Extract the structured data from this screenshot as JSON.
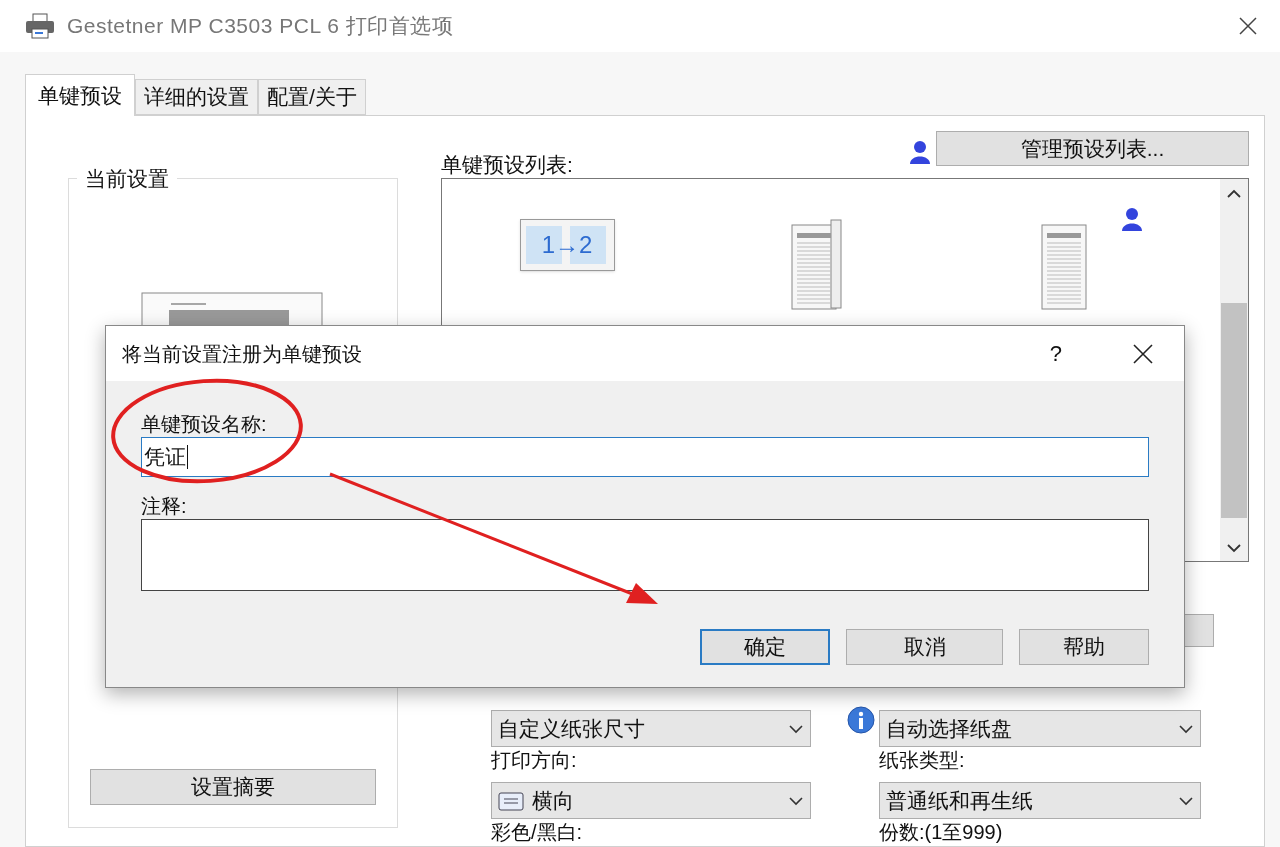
{
  "window": {
    "title": "Gestetner MP C3503 PCL 6 打印首选项"
  },
  "tabs": [
    {
      "label": "单键预设",
      "selected": true
    },
    {
      "label": "详细的设置",
      "selected": false
    },
    {
      "label": "配置/关于",
      "selected": false
    }
  ],
  "current_settings": {
    "title": "当前设置",
    "summary_button": "设置摘要"
  },
  "preset_list": {
    "label": "单键预设列表:",
    "manage_button": "管理预设列表...",
    "items": [
      {
        "kind": "duplex",
        "label": "1→2",
        "user": false
      },
      {
        "kind": "booklet",
        "user": false
      },
      {
        "kind": "document",
        "user": true
      }
    ]
  },
  "settings": [
    {
      "value": "自定义纸张尺寸",
      "kind": "select"
    },
    {
      "value": "自动选择纸盘",
      "kind": "select-info"
    },
    {
      "label": "打印方向:",
      "value": "横向",
      "kind": "select-orientation"
    },
    {
      "label": "纸张类型:",
      "value": "普通纸和再生纸",
      "kind": "select"
    },
    {
      "label": "彩色/黑白:",
      "kind": "label"
    },
    {
      "label": "份数:(1至999)",
      "kind": "label"
    }
  ],
  "dialog": {
    "title": "将当前设置注册为单键预设",
    "help": "?",
    "name_label": "单键预设名称:",
    "name_value": "凭证",
    "comment_label": "注释:",
    "buttons": [
      {
        "label": "确定",
        "default": true
      },
      {
        "label": "取消",
        "default": false
      },
      {
        "label": "帮助",
        "default": false
      }
    ]
  }
}
